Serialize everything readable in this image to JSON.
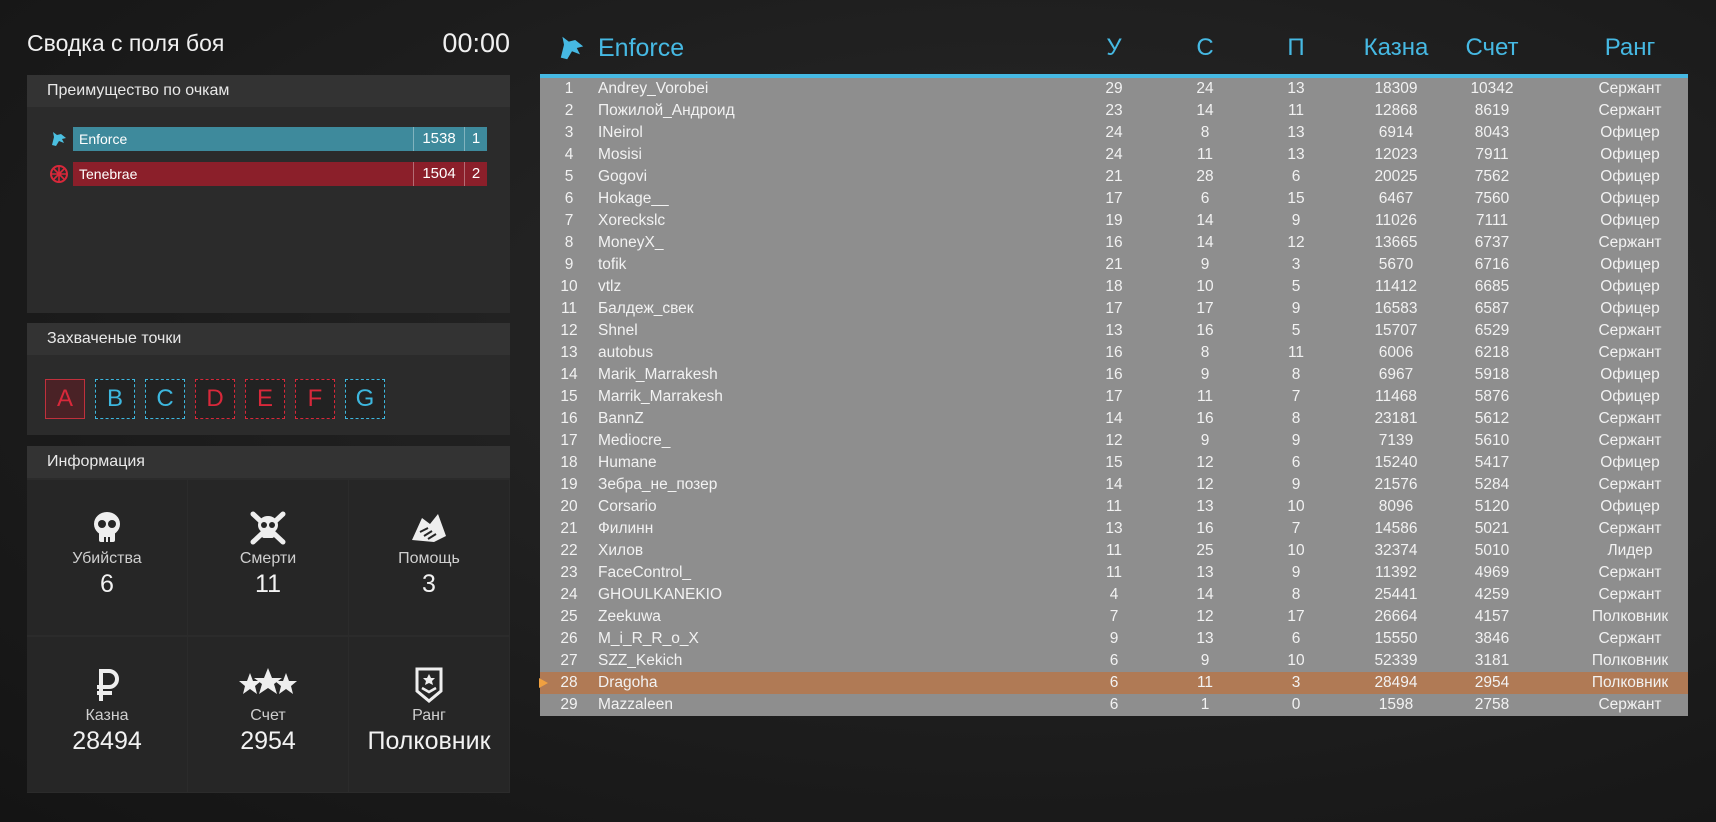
{
  "summary": {
    "title": "Сводка с поля боя",
    "timer": "00:00",
    "advantage_title": "Преимущество по очкам",
    "teams": [
      {
        "name": "Enforce",
        "score": "1538",
        "place": "1",
        "color": "#3e8a9c",
        "icon": "wolf-icon"
      },
      {
        "name": "Tenebrae",
        "score": "1504",
        "place": "2",
        "color": "#8b1f2a",
        "icon": "star-wheel-icon"
      }
    ],
    "points_title": "Захваченые точки",
    "points": [
      {
        "label": "A",
        "team": "red",
        "selected": true
      },
      {
        "label": "B",
        "team": "blue"
      },
      {
        "label": "C",
        "team": "blue"
      },
      {
        "label": "D",
        "team": "red"
      },
      {
        "label": "E",
        "team": "red"
      },
      {
        "label": "F",
        "team": "red"
      },
      {
        "label": "G",
        "team": "blue"
      }
    ],
    "info_title": "Информация",
    "stats": [
      {
        "label": "Убийства",
        "value": "6",
        "icon": "skull-icon"
      },
      {
        "label": "Смерти",
        "value": "11",
        "icon": "skull-crossbones-icon"
      },
      {
        "label": "Помощь",
        "value": "3",
        "icon": "handshake-icon"
      },
      {
        "label": "Казна",
        "value": "28494",
        "icon": "ruble-icon"
      },
      {
        "label": "Счет",
        "value": "2954",
        "icon": "stars-icon"
      },
      {
        "label": "Ранг",
        "value": "Полковник",
        "icon": "rank-badge-icon"
      }
    ]
  },
  "scoreboard": {
    "team": "Enforce",
    "accent": "#46b9e3",
    "columns": {
      "kills": "У",
      "deaths": "С",
      "assists": "П",
      "treasury": "Казна",
      "score": "Счет",
      "rank": "Ранг"
    },
    "rows": [
      {
        "n": "1",
        "name": "Andrey_Vorobei",
        "k": "29",
        "d": "24",
        "a": "13",
        "t": "18309",
        "s": "10342",
        "r": "Сержант"
      },
      {
        "n": "2",
        "name": "Пожилой_Андроид",
        "k": "23",
        "d": "14",
        "a": "11",
        "t": "12868",
        "s": "8619",
        "r": "Сержант"
      },
      {
        "n": "3",
        "name": "INeirol",
        "k": "24",
        "d": "8",
        "a": "13",
        "t": "6914",
        "s": "8043",
        "r": "Офицер"
      },
      {
        "n": "4",
        "name": "Mosisi",
        "k": "24",
        "d": "11",
        "a": "13",
        "t": "12023",
        "s": "7911",
        "r": "Офицер"
      },
      {
        "n": "5",
        "name": "Gogovi",
        "k": "21",
        "d": "28",
        "a": "6",
        "t": "20025",
        "s": "7562",
        "r": "Офицер"
      },
      {
        "n": "6",
        "name": "Hokage__",
        "k": "17",
        "d": "6",
        "a": "15",
        "t": "6467",
        "s": "7560",
        "r": "Офицер"
      },
      {
        "n": "7",
        "name": "Xoreckslc",
        "k": "19",
        "d": "14",
        "a": "9",
        "t": "11026",
        "s": "7111",
        "r": "Офицер"
      },
      {
        "n": "8",
        "name": "MoneyX_",
        "k": "16",
        "d": "14",
        "a": "12",
        "t": "13665",
        "s": "6737",
        "r": "Сержант"
      },
      {
        "n": "9",
        "name": "tofik",
        "k": "21",
        "d": "9",
        "a": "3",
        "t": "5670",
        "s": "6716",
        "r": "Офицер"
      },
      {
        "n": "10",
        "name": "vtlz",
        "k": "18",
        "d": "10",
        "a": "5",
        "t": "11412",
        "s": "6685",
        "r": "Офицер"
      },
      {
        "n": "11",
        "name": "Балдеж_свек",
        "k": "17",
        "d": "17",
        "a": "9",
        "t": "16583",
        "s": "6587",
        "r": "Офицер"
      },
      {
        "n": "12",
        "name": "Shnel",
        "k": "13",
        "d": "16",
        "a": "5",
        "t": "15707",
        "s": "6529",
        "r": "Сержант"
      },
      {
        "n": "13",
        "name": "autobus",
        "k": "16",
        "d": "8",
        "a": "11",
        "t": "6006",
        "s": "6218",
        "r": "Сержант"
      },
      {
        "n": "14",
        "name": "Marik_Marrakesh",
        "k": "16",
        "d": "9",
        "a": "8",
        "t": "6967",
        "s": "5918",
        "r": "Офицер"
      },
      {
        "n": "15",
        "name": "Marrik_Marrakesh",
        "k": "17",
        "d": "11",
        "a": "7",
        "t": "11468",
        "s": "5876",
        "r": "Офицер"
      },
      {
        "n": "16",
        "name": "BannZ",
        "k": "14",
        "d": "16",
        "a": "8",
        "t": "23181",
        "s": "5612",
        "r": "Сержант"
      },
      {
        "n": "17",
        "name": "Mediocre_",
        "k": "12",
        "d": "9",
        "a": "9",
        "t": "7139",
        "s": "5610",
        "r": "Сержант"
      },
      {
        "n": "18",
        "name": "Humane",
        "k": "15",
        "d": "12",
        "a": "6",
        "t": "15240",
        "s": "5417",
        "r": "Офицер"
      },
      {
        "n": "19",
        "name": "Зебра_не_позер",
        "k": "14",
        "d": "12",
        "a": "9",
        "t": "21576",
        "s": "5284",
        "r": "Сержант"
      },
      {
        "n": "20",
        "name": "Corsario",
        "k": "11",
        "d": "13",
        "a": "10",
        "t": "8096",
        "s": "5120",
        "r": "Офицер"
      },
      {
        "n": "21",
        "name": "Филинн",
        "k": "13",
        "d": "16",
        "a": "7",
        "t": "14586",
        "s": "5021",
        "r": "Сержант"
      },
      {
        "n": "22",
        "name": "Хилов",
        "k": "11",
        "d": "25",
        "a": "10",
        "t": "32374",
        "s": "5010",
        "r": "Лидер"
      },
      {
        "n": "23",
        "name": "FaceControl_",
        "k": "11",
        "d": "13",
        "a": "9",
        "t": "11392",
        "s": "4969",
        "r": "Сержант"
      },
      {
        "n": "24",
        "name": "GHOULKANEKIO",
        "k": "4",
        "d": "14",
        "a": "8",
        "t": "25441",
        "s": "4259",
        "r": "Сержант"
      },
      {
        "n": "25",
        "name": "Zeekuwa",
        "k": "7",
        "d": "12",
        "a": "17",
        "t": "26664",
        "s": "4157",
        "r": "Полковник"
      },
      {
        "n": "26",
        "name": "M_i_R_R_o_X",
        "k": "9",
        "d": "13",
        "a": "6",
        "t": "15550",
        "s": "3846",
        "r": "Сержант"
      },
      {
        "n": "27",
        "name": "SZZ_Kekich",
        "k": "6",
        "d": "9",
        "a": "10",
        "t": "52339",
        "s": "3181",
        "r": "Полковник"
      },
      {
        "n": "28",
        "name": "Dragoha",
        "k": "6",
        "d": "11",
        "a": "3",
        "t": "28494",
        "s": "2954",
        "r": "Полковник",
        "me": true
      },
      {
        "n": "29",
        "name": "Mazzaleen",
        "k": "6",
        "d": "1",
        "a": "0",
        "t": "1598",
        "s": "2758",
        "r": "Сержант"
      }
    ]
  }
}
